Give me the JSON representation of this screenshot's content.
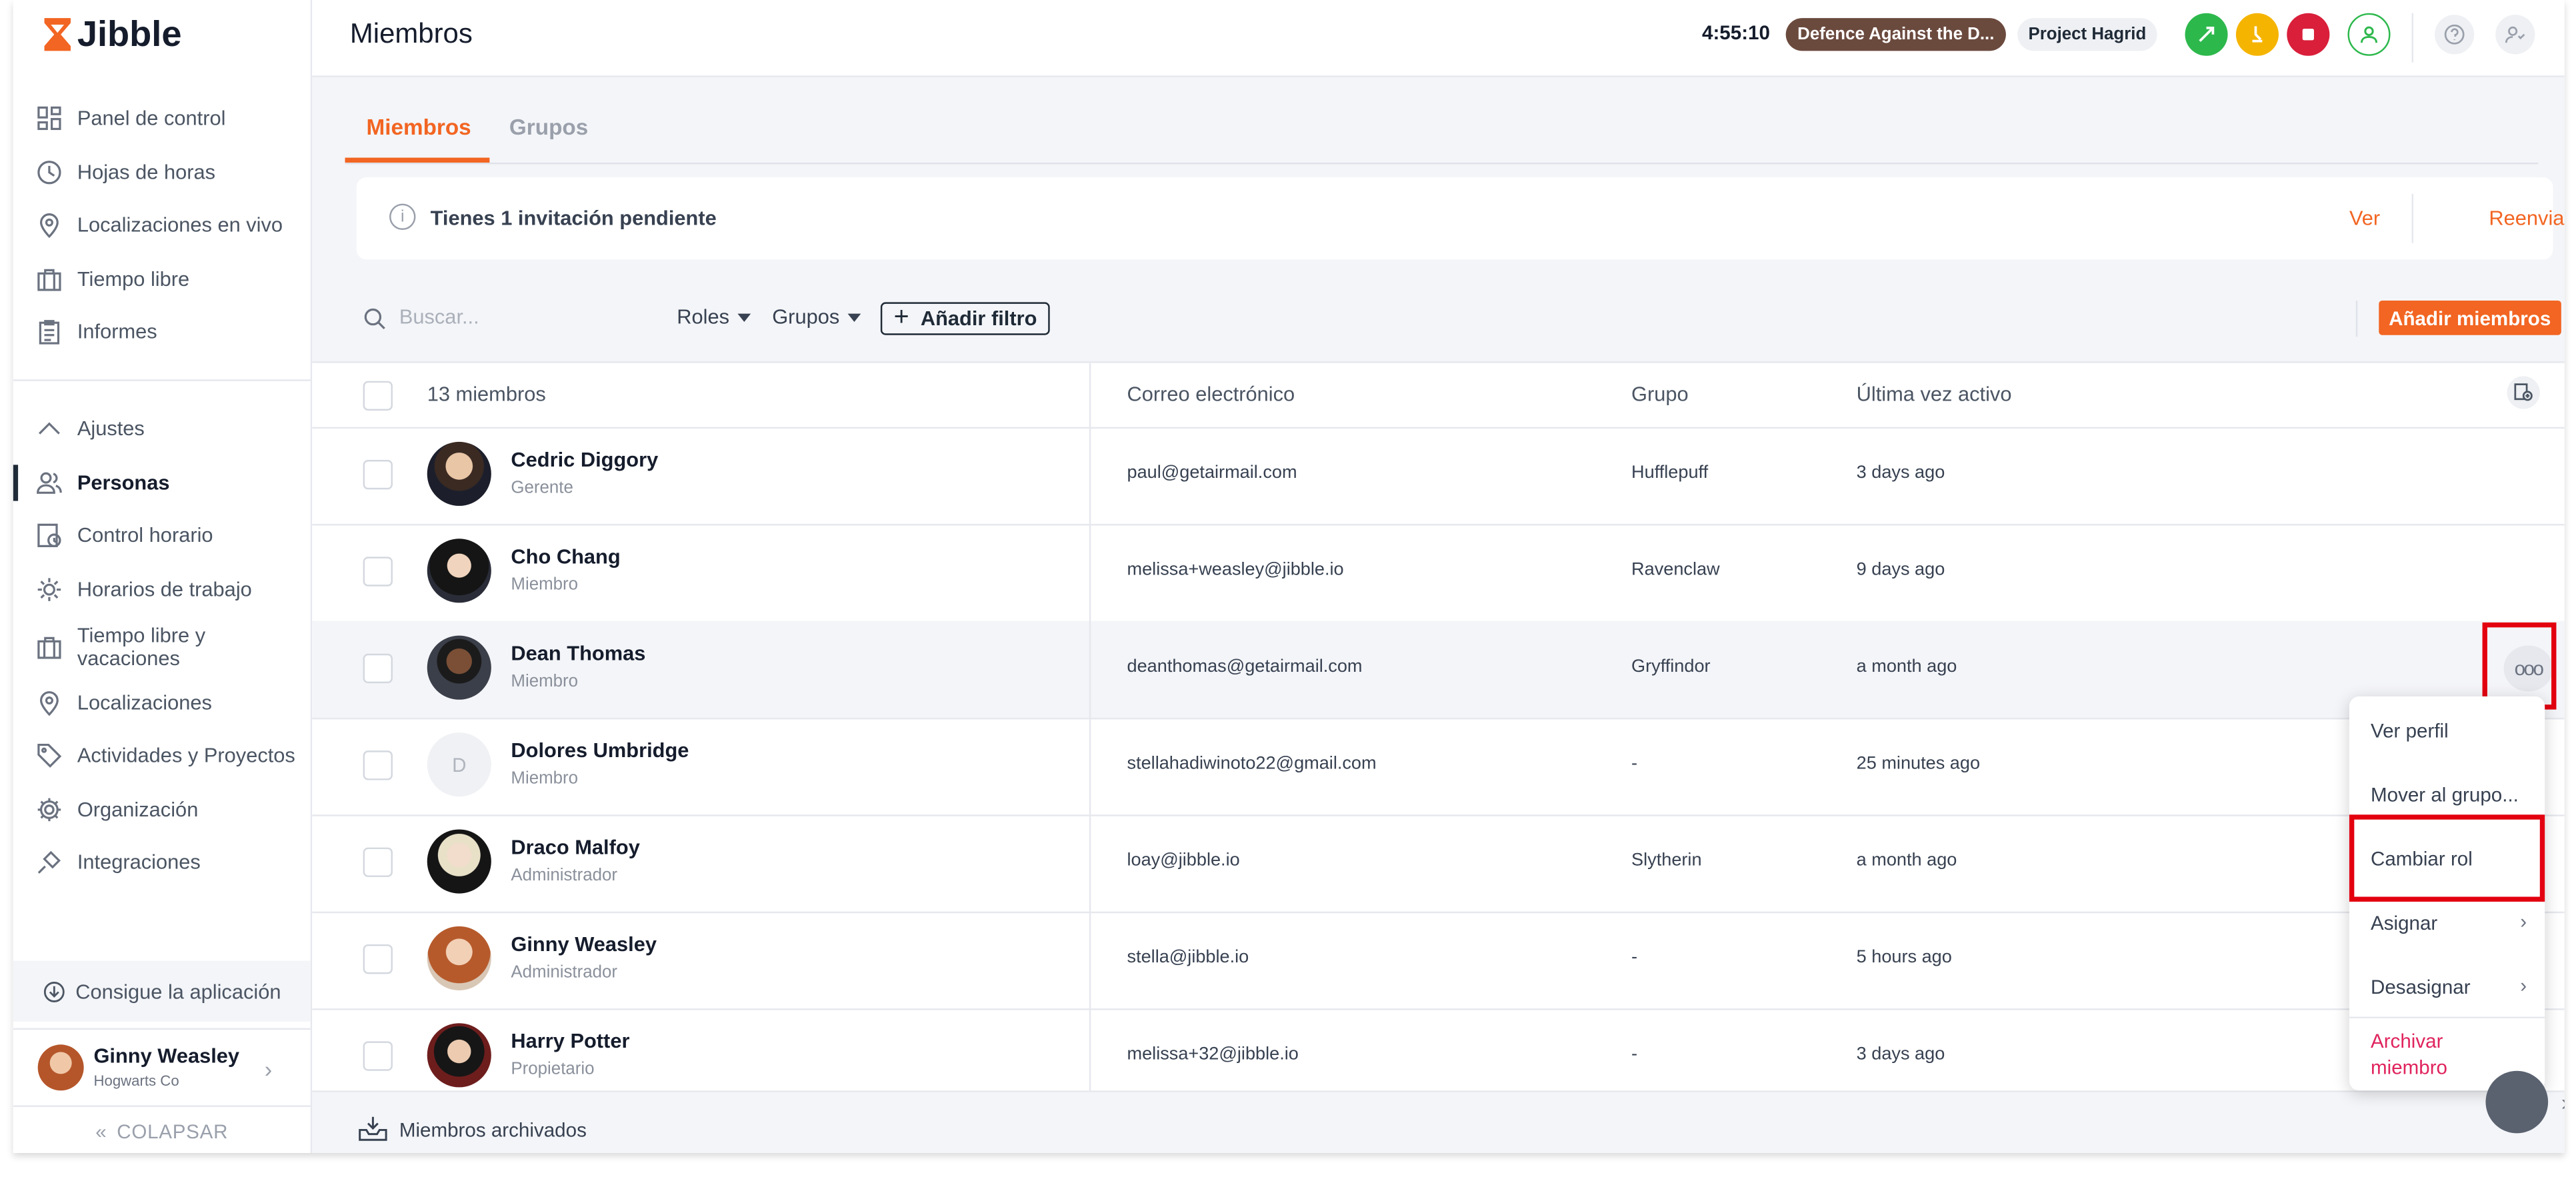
{
  "app": {
    "name": "Jibble"
  },
  "sidebar": {
    "items": [
      {
        "label": "Panel de control"
      },
      {
        "label": "Hojas de horas"
      },
      {
        "label": "Localizaciones en vivo"
      },
      {
        "label": "Tiempo libre"
      },
      {
        "label": "Informes"
      },
      {
        "label": "Ajustes"
      },
      {
        "label": "Personas"
      },
      {
        "label": "Control horario"
      },
      {
        "label": "Horarios de trabajo"
      },
      {
        "label": "Tiempo libre y vacaciones"
      },
      {
        "label": "Localizaciones"
      },
      {
        "label": "Actividades y Proyectos"
      },
      {
        "label": "Organización"
      },
      {
        "label": "Integraciones"
      }
    ],
    "get_app": "Consigue la aplicación",
    "user": {
      "name": "Ginny Weasley",
      "org": "Hogwarts Co"
    },
    "collapse": "COLAPSAR"
  },
  "header": {
    "title": "Miembros",
    "timer": "4:55:10",
    "activity": "Defence Against the D...",
    "project": "Project Hagrid"
  },
  "tabs": [
    {
      "label": "Miembros"
    },
    {
      "label": "Grupos"
    }
  ],
  "invite": {
    "text": "Tienes 1 invitación pendiente",
    "view": "Ver",
    "resend": "Reenviar"
  },
  "filters": {
    "search_placeholder": "Buscar...",
    "roles": "Roles",
    "groups": "Grupos",
    "add_filter": "Añadir filtro",
    "add_members": "Añadir miembros"
  },
  "table": {
    "headers": {
      "count": "13 miembros",
      "email": "Correo electrónico",
      "group": "Grupo",
      "last_active": "Última vez activo"
    },
    "rows": [
      {
        "name": "Cedric Diggory",
        "role": "Gerente",
        "email": "paul@getairmail.com",
        "group": "Hufflepuff",
        "last": "3 days ago"
      },
      {
        "name": "Cho Chang",
        "role": "Miembro",
        "email": "melissa+weasley@jibble.io",
        "group": "Ravenclaw",
        "last": "9 days ago"
      },
      {
        "name": "Dean Thomas",
        "role": "Miembro",
        "email": "deanthomas@getairmail.com",
        "group": "Gryffindor",
        "last": "a month ago"
      },
      {
        "name": "Dolores Umbridge",
        "role": "Miembro",
        "email": "stellahadiwinoto22@gmail.com",
        "group": "-",
        "last": "25 minutes ago",
        "initial": "D"
      },
      {
        "name": "Draco Malfoy",
        "role": "Administrador",
        "email": "loay@jibble.io",
        "group": "Slytherin",
        "last": "a month ago"
      },
      {
        "name": "Ginny Weasley",
        "role": "Administrador",
        "email": "stella@jibble.io",
        "group": "-",
        "last": "5 hours ago"
      },
      {
        "name": "Harry Potter",
        "role": "Propietario",
        "email": "melissa+32@jibble.io",
        "group": "-",
        "last": "3 days ago"
      }
    ]
  },
  "row_menu": {
    "more": "ooo",
    "items": [
      {
        "label": "Ver perfil"
      },
      {
        "label": "Mover al grupo..."
      },
      {
        "label": "Cambiar rol"
      },
      {
        "label": "Asignar"
      },
      {
        "label": "Desasignar"
      },
      {
        "label": "Archivar miembro"
      }
    ]
  },
  "footer": {
    "archived": "Miembros archivados"
  },
  "colors": {
    "accent": "#f26522",
    "highlight": "#e3000f",
    "danger": "#e0245e"
  }
}
